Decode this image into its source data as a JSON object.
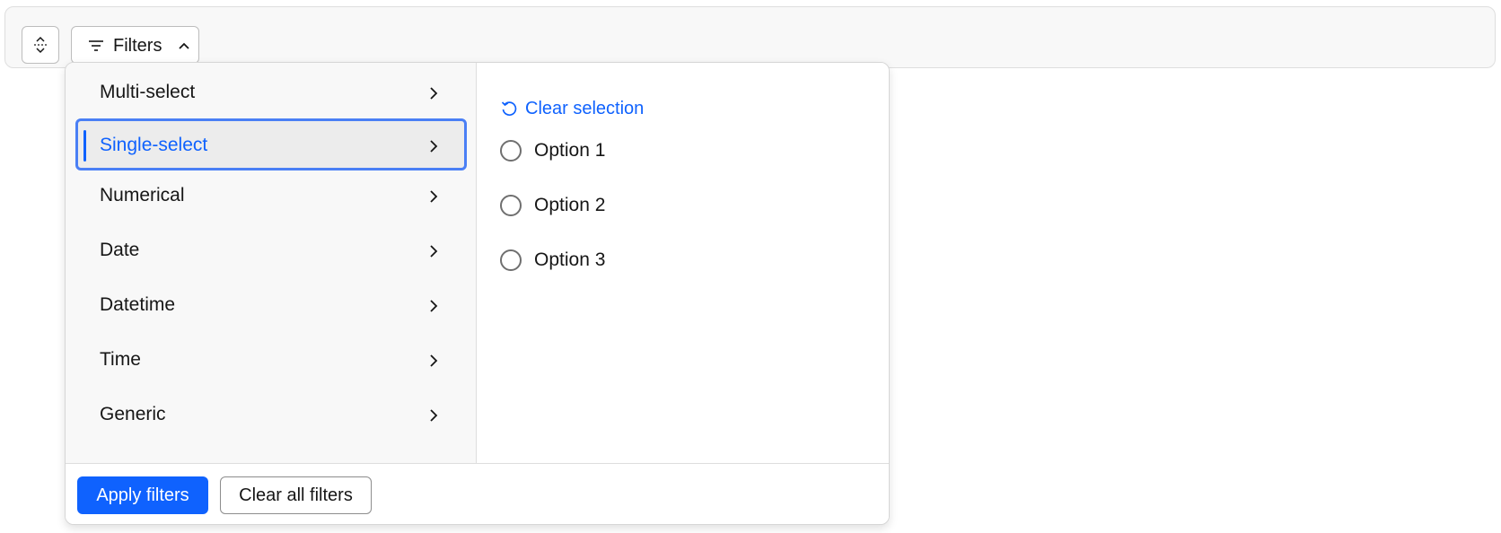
{
  "toolbar": {
    "collapse_icon": "expand-collapse-icon",
    "filters_button": {
      "label": "Filters",
      "icon": "filter-icon",
      "chevron": "chevron-up-icon"
    }
  },
  "panel": {
    "categories": [
      {
        "label": "Multi-select",
        "selected": false
      },
      {
        "label": "Single-select",
        "selected": true
      },
      {
        "label": "Numerical",
        "selected": false
      },
      {
        "label": "Date",
        "selected": false
      },
      {
        "label": "Datetime",
        "selected": false
      },
      {
        "label": "Time",
        "selected": false
      },
      {
        "label": "Generic",
        "selected": false
      }
    ],
    "clear_selection_label": "Clear selection",
    "options": [
      {
        "label": "Option 1",
        "checked": false
      },
      {
        "label": "Option 2",
        "checked": false
      },
      {
        "label": "Option 3",
        "checked": false
      }
    ],
    "footer": {
      "apply_label": "Apply filters",
      "clear_all_label": "Clear all filters"
    }
  },
  "colors": {
    "accent": "#0f62fe",
    "focus_ring": "#4a7ff5",
    "panel_left_bg": "#f8f8f8",
    "selected_bg": "#ececec"
  }
}
